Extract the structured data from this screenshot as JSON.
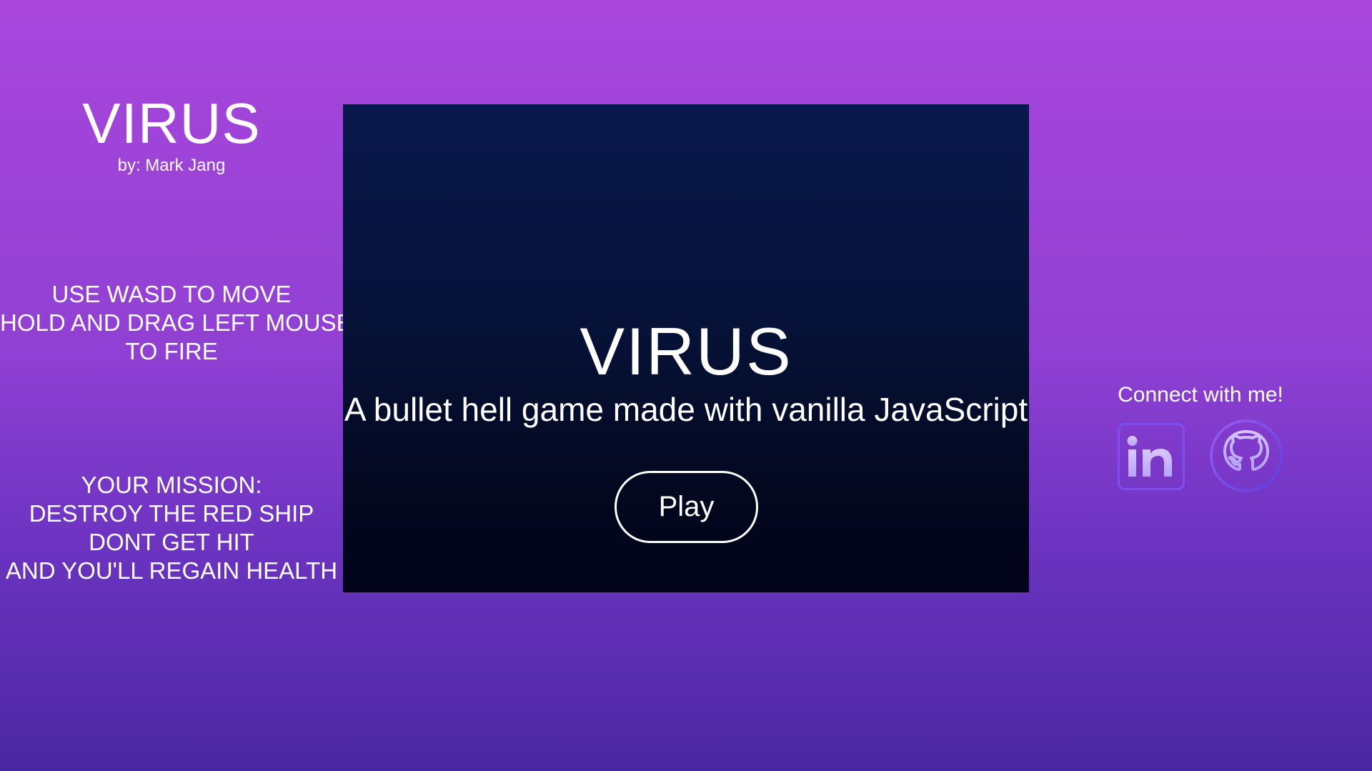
{
  "side": {
    "title": "VIRUS",
    "author": "by: Mark Jang",
    "instructions": [
      "USE WASD TO MOVE",
      "HOLD AND DRAG LEFT MOUSE",
      "TO FIRE"
    ],
    "mission": [
      "YOUR MISSION:",
      "DESTROY THE RED SHIP",
      "DONT GET HIT",
      "AND YOU'LL REGAIN HEALTH"
    ]
  },
  "game": {
    "title": "VIRUS",
    "subtitle": "A bullet hell game made with vanilla JavaScript",
    "play_label": "Play"
  },
  "connect": {
    "label": "Connect with me!",
    "icons": [
      "linkedin-icon",
      "github-icon"
    ]
  },
  "colors": {
    "background_top": "#a946dc",
    "background_bottom": "#4a27a2",
    "canvas_top": "#09184c",
    "canvas_bottom": "#01031a",
    "icon_outline": "#7b4ff0",
    "icon_fill": "#c7b8ff"
  }
}
